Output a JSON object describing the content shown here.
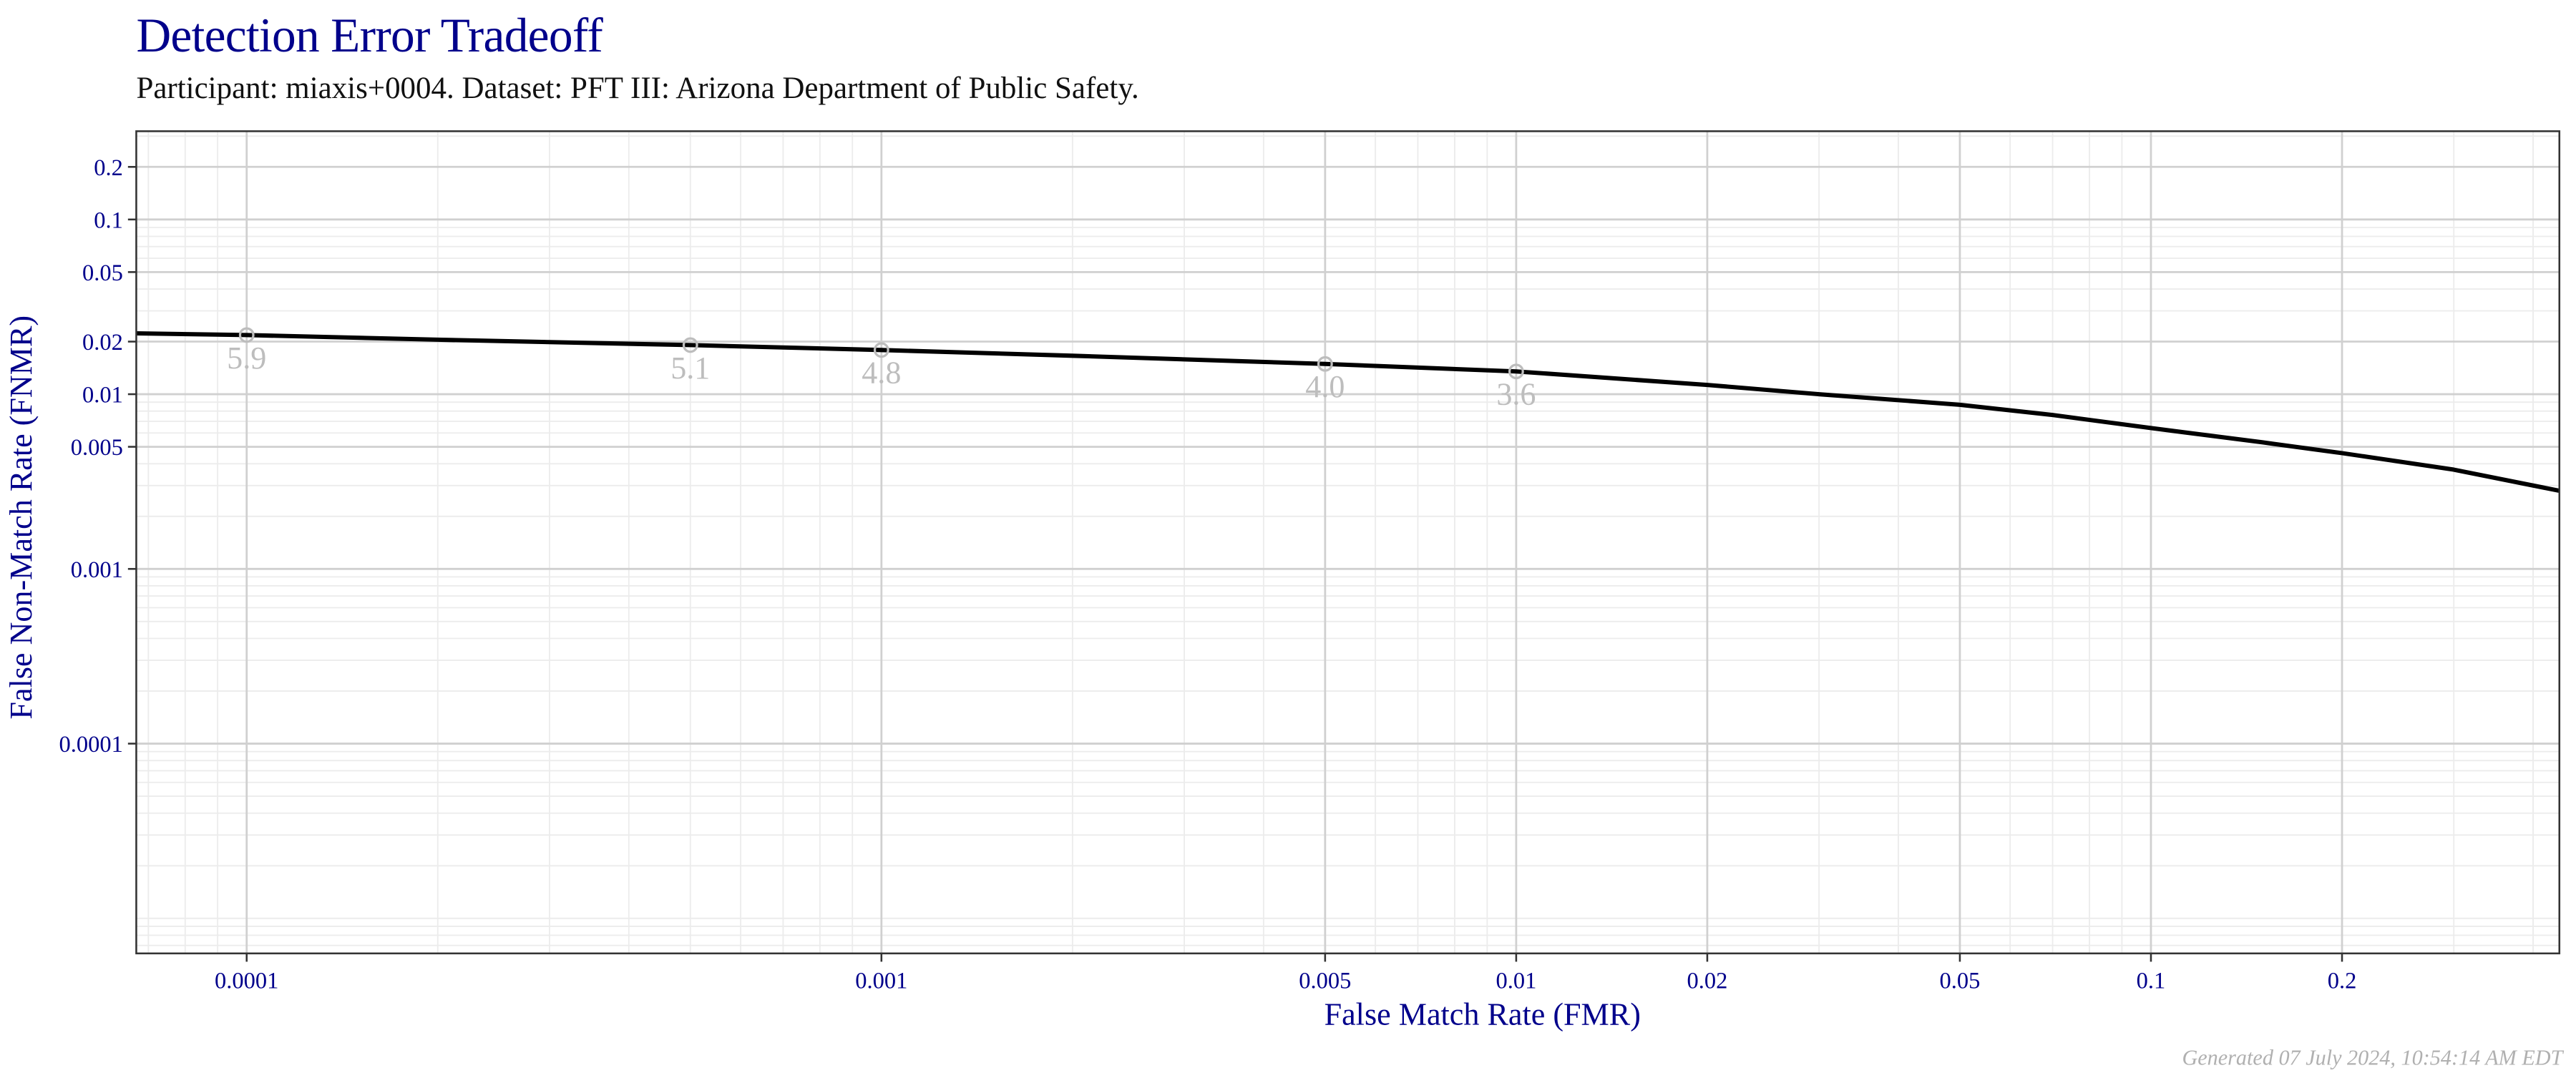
{
  "header": {
    "title": "Detection Error Tradeoff",
    "subtitle": "Participant: miaxis+0004. Dataset: PFT III: Arizona Department of Public Safety."
  },
  "footer": {
    "generated": "Generated 07 July 2024, 10:54:14 AM EDT"
  },
  "colors": {
    "title": "#00008b",
    "axis_text": "#00008b",
    "curve": "#000000",
    "point_marker": "#bdbdbd",
    "grid_major": "#d0d0d0",
    "grid_minor": "#ececec",
    "panel_border": "#333333"
  },
  "chart_data": {
    "type": "line",
    "title": "Detection Error Tradeoff",
    "subtitle": "Participant: miaxis+0004. Dataset: PFT III: Arizona Department of Public Safety.",
    "xlabel": "False Match Rate (FMR)",
    "ylabel": "False Non-Match Rate (FNMR)",
    "xscale": "log10",
    "yscale": "log10",
    "xlim": [
      6.7e-05,
      0.44
    ],
    "ylim": [
      6.3e-06,
      0.32
    ],
    "grid": true,
    "legend": "none",
    "x_ticks": [
      {
        "value": 0.0001,
        "label": "0.0001"
      },
      {
        "value": 0.001,
        "label": "0.001"
      },
      {
        "value": 0.005,
        "label": "0.005"
      },
      {
        "value": 0.01,
        "label": "0.01"
      },
      {
        "value": 0.02,
        "label": "0.02"
      },
      {
        "value": 0.05,
        "label": "0.05"
      },
      {
        "value": 0.1,
        "label": "0.1"
      },
      {
        "value": 0.2,
        "label": "0.2"
      }
    ],
    "y_ticks": [
      {
        "value": 0.2,
        "label": "0.2"
      },
      {
        "value": 0.1,
        "label": "0.1"
      },
      {
        "value": 0.05,
        "label": "0.05"
      },
      {
        "value": 0.02,
        "label": "0.02"
      },
      {
        "value": 0.01,
        "label": "0.01"
      },
      {
        "value": 0.005,
        "label": "0.005"
      },
      {
        "value": 0.001,
        "label": "0.001"
      },
      {
        "value": 0.0001,
        "label": "0.0001"
      }
    ],
    "series": [
      {
        "name": "miaxis+0004",
        "x": [
          6.7e-05,
          0.0001,
          0.0002,
          0.0005,
          0.001,
          0.002,
          0.005,
          0.01,
          0.02,
          0.03,
          0.05,
          0.07,
          0.1,
          0.15,
          0.2,
          0.3,
          0.44
        ],
        "y": [
          0.0223,
          0.0218,
          0.0205,
          0.0191,
          0.0179,
          0.0166,
          0.0149,
          0.0135,
          0.0113,
          0.01,
          0.0087,
          0.0076,
          0.0064,
          0.0053,
          0.0046,
          0.0037,
          0.0028
        ]
      }
    ],
    "annotations": [
      {
        "fmr": 0.0001,
        "fnmr": 0.0218,
        "label": "5.9"
      },
      {
        "fmr": 0.0005,
        "fnmr": 0.0191,
        "label": "5.1"
      },
      {
        "fmr": 0.001,
        "fnmr": 0.0179,
        "label": "4.8"
      },
      {
        "fmr": 0.005,
        "fnmr": 0.0149,
        "label": "4.0"
      },
      {
        "fmr": 0.01,
        "fnmr": 0.0135,
        "label": "3.6"
      }
    ]
  }
}
